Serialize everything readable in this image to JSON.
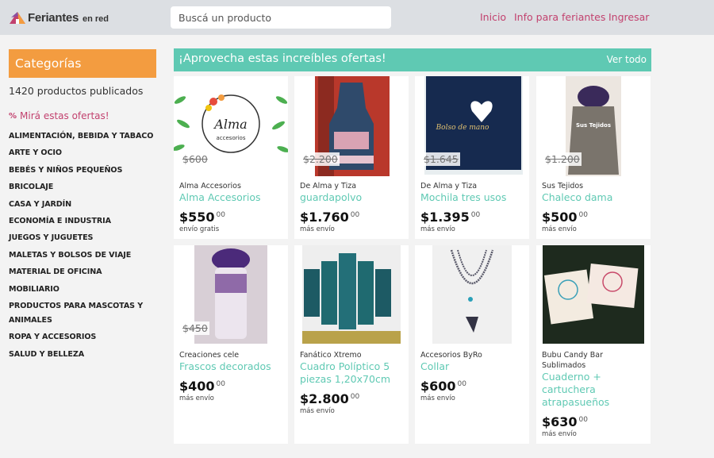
{
  "header": {
    "logo_name": "Feriantes",
    "logo_sub": "en red",
    "search_placeholder": "Buscá un producto",
    "nav": [
      "Inicio",
      "Info para feriantes",
      "Ingresar"
    ]
  },
  "sidebar": {
    "categories_title": "Categorías",
    "product_count": "1420 productos publicados",
    "offers_link": "Mirá estas ofertas!",
    "categories": [
      "ALIMENTACIÓN, BEBIDA Y TABACO",
      "ARTE Y OCIO",
      "BEBÉS Y NIÑOS PEQUEÑOS",
      "BRICOLAJE",
      "CASA Y JARDÍN",
      "ECONOMÍA E INDUSTRIA",
      "JUEGOS Y JUGUETES",
      "MALETAS Y BOLSOS DE VIAJE",
      "MATERIAL DE OFICINA",
      "MOBILIARIO",
      "PRODUCTOS PARA MASCOTAS Y ANIMALES",
      "ROPA Y ACCESORIOS",
      "SALUD Y BELLEZA"
    ]
  },
  "offers": {
    "title": "¡Aprovecha estas increíbles ofertas!",
    "see_all": "Ver todo",
    "products": [
      {
        "seller": "Alma Accesorios",
        "title": "Alma Accesorios",
        "old_price": "$600",
        "price": "$550",
        "cents": "00",
        "shipping": "envío gratis",
        "img_text": "Alma",
        "img_sub": "accesorios"
      },
      {
        "seller": "De Alma y Tiza",
        "title": "guardapolvo",
        "old_price": "$2.200",
        "price": "$1.760",
        "cents": "00",
        "shipping": "más envío"
      },
      {
        "seller": "De Alma y Tiza",
        "title": "Mochila tres usos",
        "old_price": "$1.645",
        "price": "$1.395",
        "cents": "00",
        "shipping": "más envío",
        "img_text": "Bolso de mano"
      },
      {
        "seller": "Sus Tejidos",
        "title": "Chaleco dama",
        "old_price": "$1.200",
        "price": "$500",
        "cents": "00",
        "shipping": "más envío",
        "img_text": "Sus Tejidos"
      },
      {
        "seller": "Creaciones cele",
        "title": "Frascos decorados",
        "old_price": "$450",
        "price": "$400",
        "cents": "00",
        "shipping": "más envío"
      },
      {
        "seller": "Fanático Xtremo",
        "title": "Cuadro Políptico 5 piezas 1,20x70cm",
        "old_price": "",
        "price": "$2.800",
        "cents": "00",
        "shipping": "más envío"
      },
      {
        "seller": "Accesorios ByRo",
        "title": "Collar",
        "old_price": "",
        "price": "$600",
        "cents": "00",
        "shipping": "más envío"
      },
      {
        "seller": "Bubu Candy Bar Sublimados",
        "title": "Cuaderno + cartuchera atrapasueños",
        "old_price": "",
        "price": "$630",
        "cents": "00",
        "shipping": "más envío"
      }
    ]
  },
  "colors": {
    "accent_pink": "#c2416e",
    "accent_teal": "#5fc9b3",
    "accent_orange": "#f39c40"
  }
}
